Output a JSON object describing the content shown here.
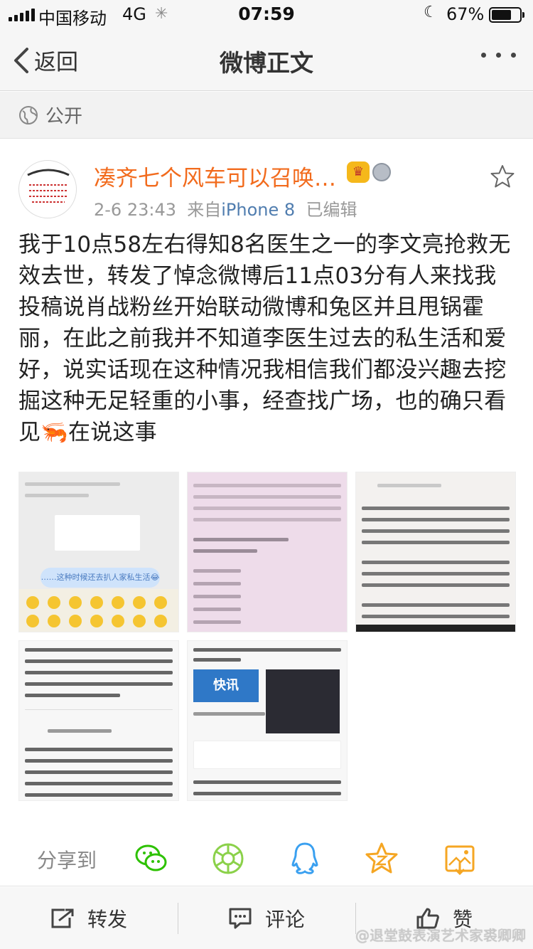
{
  "status_bar": {
    "carrier": "中国移动",
    "network": "4G",
    "time": "07:59",
    "battery": "67%"
  },
  "nav": {
    "back_label": "返回",
    "title": "微博正文"
  },
  "visibility": {
    "label": "公开"
  },
  "post": {
    "username": "凑齐七个风车可以召唤…",
    "date": "2-6 23:43",
    "source_prefix": "来自",
    "source": "iPhone 8",
    "edited": "已编辑",
    "text": "我于10点58左右得知8名医生之一的李文亮抢救无效去世，转发了悼念微博后11点03分有人来找我投稿说肖战粉丝开始联动微博和兔区并且甩锅霍丽，在此之前我并不知道李医生过去的私生活和爱好，说实话现在这种情况我相信我们都没兴趣去挖掘这种无足轻重的小事，经查找广场，也的确只看见🦐在说这事",
    "images": {
      "img1_bubble": "……这种时候还去扒人家私生活😂",
      "img5_card": "快讯"
    }
  },
  "share": {
    "label": "分享到"
  },
  "actions": {
    "repost": "转发",
    "comment": "评论",
    "like": "赞"
  },
  "watermark": "@退堂鼓表演艺术家裘卿卿",
  "colors": {
    "username": "#f26b1d",
    "source_link": "#507daf",
    "wechat": "#2dc100",
    "moments": "#8bd14a",
    "qq": "#3aa0f0",
    "weibo_favorite": "#f5a623"
  },
  "icons": [
    "back-arrow-icon",
    "more-icon",
    "globe-icon",
    "star-icon",
    "wechat-icon",
    "moments-icon",
    "qq-icon",
    "weibo-share-icon",
    "save-image-icon",
    "repost-icon",
    "comment-icon",
    "like-icon"
  ]
}
